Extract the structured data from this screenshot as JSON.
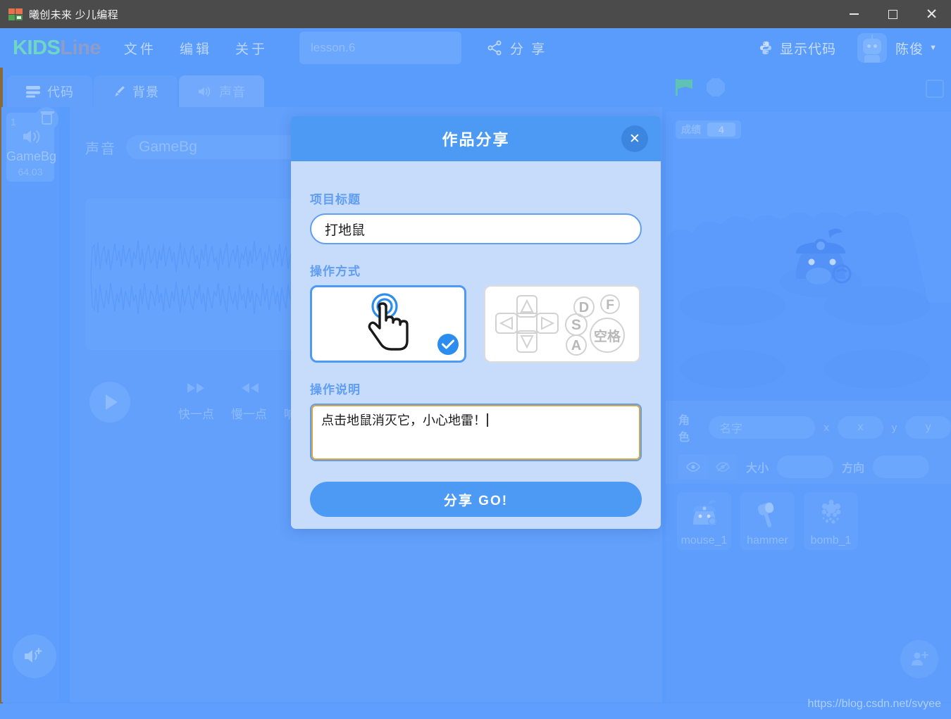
{
  "window": {
    "title": "曦创未来 少儿编程",
    "app_icon": "windows-logo-icon",
    "minimize": "−",
    "maximize": "□",
    "close": "✕"
  },
  "header": {
    "logo_kids": "KIDS",
    "logo_line": "Line",
    "menus": [
      "文件",
      "编辑",
      "关于"
    ],
    "lesson_field": "lesson.6",
    "share_label": "分 享",
    "show_code_label": "显示代码",
    "username": "陈俊",
    "caret": "▼"
  },
  "tabs": [
    {
      "label": "代码",
      "icon": "blocks-icon",
      "active": false
    },
    {
      "label": "背景",
      "icon": "paintbrush-icon",
      "active": false
    },
    {
      "label": "声音",
      "icon": "speaker-icon",
      "active": true
    }
  ],
  "sound_list": {
    "items": [
      {
        "index": "1",
        "name": "GameBg",
        "duration": "64.03"
      }
    ],
    "add_button": "add-sound-icon"
  },
  "sound_editor": {
    "field_label": "声音",
    "sound_name": "GameBg",
    "play_label": "play",
    "effects": [
      {
        "label": "快一点",
        "icon": "fast-forward-icon"
      },
      {
        "label": "慢一点",
        "icon": "rewind-icon"
      },
      {
        "label": "响一点",
        "icon": "volume-up-icon"
      }
    ]
  },
  "stage": {
    "green_flag": "green-flag-icon",
    "stop_button": "stop-icon",
    "score_label": "成绩",
    "score_value": "4"
  },
  "sprite_info": {
    "role_label": "角色",
    "name_placeholder": "名字",
    "x_label": "x",
    "x_value": "x",
    "y_label": "y",
    "y_value": "y",
    "size_label": "大小",
    "size_value": "",
    "direction_label": "方向",
    "direction_value": "",
    "show_icon": "eye-icon",
    "hide_icon": "eye-off-icon"
  },
  "sprites": [
    {
      "name": "mouse_1",
      "icon": "mole-sprite-icon"
    },
    {
      "name": "hammer",
      "icon": "hammer-sprite-icon"
    },
    {
      "name": "bomb_1",
      "icon": "bomb-sprite-icon"
    }
  ],
  "modal": {
    "title": "作品分享",
    "close_label": "✕",
    "project_title_label": "项目标题",
    "project_title_value": "打地鼠",
    "mode_label": "操作方式",
    "modes": [
      {
        "name": "touch",
        "icon": "tap-hand-icon",
        "selected": true
      },
      {
        "name": "keyboard",
        "icon": "dpad-keys-icon",
        "selected": false
      }
    ],
    "keyboard_keys": [
      "S",
      "A",
      "D",
      "F",
      "空格"
    ],
    "desc_label": "操作说明",
    "desc_value": "点击地鼠消灭它，小心地雷！",
    "submit_label": "分享 GO!"
  },
  "watermark": "https://blog.csdn.net/svyee",
  "colors": {
    "app_bg": "#5a9cfc",
    "titlebar": "#4b4b4b",
    "modal_header": "#4d9af5",
    "modal_body": "#c7dbfb",
    "accent": "#4d9af5",
    "label_blue": "#5f9ef2",
    "logo_kids": "#6fd6c6",
    "logo_line": "#8e9cc9"
  }
}
